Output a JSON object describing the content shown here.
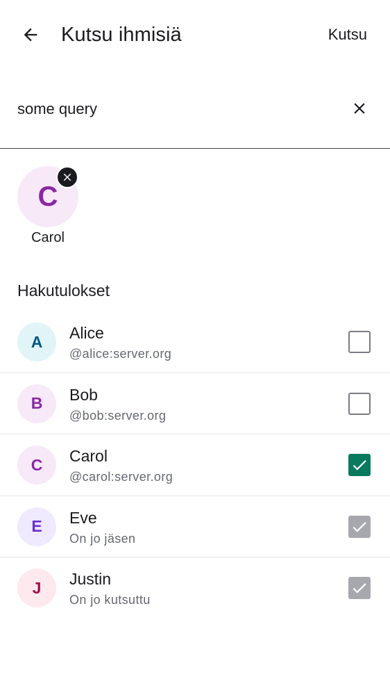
{
  "header": {
    "back_icon": "arrow-back-icon",
    "title": "Kutsu ihmisiä",
    "invite_label": "Kutsu"
  },
  "search": {
    "value": "some query",
    "clear_icon": "close-icon"
  },
  "selected": [
    {
      "initial": "C",
      "name": "Carol",
      "remove_icon": "close-icon"
    }
  ],
  "results": {
    "section_title": "Hakutulokset",
    "items": [
      {
        "initial": "A",
        "name": "Alice",
        "subtitle": "@alice:server.org",
        "state": "unchecked",
        "avatar_bg": "#e1f4f8",
        "avatar_fg": "#005a83"
      },
      {
        "initial": "B",
        "name": "Bob",
        "subtitle": "@bob:server.org",
        "state": "unchecked",
        "avatar_bg": "#f8e9f9",
        "avatar_fg": "#8a27a4"
      },
      {
        "initial": "C",
        "name": "Carol",
        "subtitle": "@carol:server.org",
        "state": "checked",
        "avatar_bg": "#f8e9f9",
        "avatar_fg": "#8a27a4"
      },
      {
        "initial": "E",
        "name": "Eve",
        "subtitle": "On jo jäsen",
        "state": "disabled-checked",
        "avatar_bg": "#efeaff",
        "avatar_fg": "#6b2fd0"
      },
      {
        "initial": "J",
        "name": "Justin",
        "subtitle": "On jo kutsuttu",
        "state": "disabled-checked",
        "avatar_bg": "#fde9ee",
        "avatar_fg": "#a40f4c"
      }
    ]
  },
  "colors": {
    "accent": "#0a7a5e",
    "disabled_check": "#a7a8ae",
    "text_primary": "#1b1b1f",
    "text_secondary": "#656870"
  }
}
